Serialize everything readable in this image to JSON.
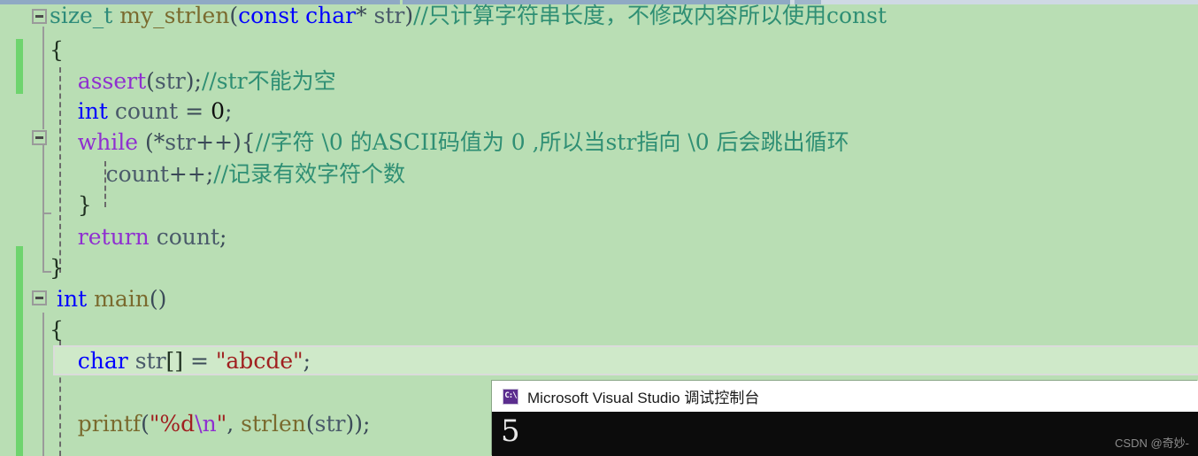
{
  "editor": {
    "background_color": "#b9deb4",
    "current_line_color": "#cfe9c9",
    "change_bar_color": "#6ed46e",
    "scrollbar": {
      "name": "horizontal-scrollbar"
    },
    "lines": [
      {
        "id": "line-1",
        "text": "size_t my_strlen(const char* str)//只计算字符串长度，不修改内容所以使用const",
        "tokens": [
          {
            "t": "size_t",
            "c": "t-type"
          },
          {
            "t": " ",
            "c": "t-punct"
          },
          {
            "t": "my_strlen",
            "c": "t-fnname"
          },
          {
            "t": "(",
            "c": "t-punct"
          },
          {
            "t": "const",
            "c": "t-keyword"
          },
          {
            "t": " ",
            "c": "t-punct"
          },
          {
            "t": "char",
            "c": "t-keyword"
          },
          {
            "t": "*",
            "c": "t-punct"
          },
          {
            "t": " ",
            "c": "t-punct"
          },
          {
            "t": "str",
            "c": "t-ident"
          },
          {
            "t": ")",
            "c": "t-punct"
          },
          {
            "t": "//只计算字符串长度，不修改内容所以使用const",
            "c": "t-comment"
          }
        ]
      },
      {
        "id": "line-2",
        "text": "{",
        "tokens": [
          {
            "t": "{",
            "c": "t-brace"
          }
        ]
      },
      {
        "id": "line-3",
        "text": "    assert(str);//str不能为空",
        "tokens": [
          {
            "t": "    ",
            "c": "t-punct"
          },
          {
            "t": "assert",
            "c": "t-ctrl"
          },
          {
            "t": "(",
            "c": "t-punct"
          },
          {
            "t": "str",
            "c": "t-ident"
          },
          {
            "t": ");",
            "c": "t-punct"
          },
          {
            "t": "//str不能为空",
            "c": "t-comment"
          }
        ]
      },
      {
        "id": "line-4",
        "text": "    int count = 0;",
        "tokens": [
          {
            "t": "    ",
            "c": "t-punct"
          },
          {
            "t": "int",
            "c": "t-keyword"
          },
          {
            "t": " ",
            "c": "t-punct"
          },
          {
            "t": "count",
            "c": "t-ident"
          },
          {
            "t": " = ",
            "c": "t-punct"
          },
          {
            "t": "0",
            "c": "t-num"
          },
          {
            "t": ";",
            "c": "t-punct"
          }
        ]
      },
      {
        "id": "line-5",
        "text": "    while (*str++){//字符 \\0 的ASCII码值为 0 ,所以当str指向 \\0 后会跳出循环",
        "tokens": [
          {
            "t": "    ",
            "c": "t-punct"
          },
          {
            "t": "while",
            "c": "t-ctrl"
          },
          {
            "t": " (*",
            "c": "t-punct"
          },
          {
            "t": "str",
            "c": "t-ident"
          },
          {
            "t": "++){",
            "c": "t-punct"
          },
          {
            "t": "//字符 \\0 的ASCII码值为 0 ,所以当str指向 \\0 后会跳出循环",
            "c": "t-comment"
          }
        ]
      },
      {
        "id": "line-6",
        "text": "        count++;//记录有效字符个数",
        "tokens": [
          {
            "t": "        ",
            "c": "t-punct"
          },
          {
            "t": "count",
            "c": "t-ident"
          },
          {
            "t": "++;",
            "c": "t-punct"
          },
          {
            "t": "//记录有效字符个数",
            "c": "t-comment"
          }
        ]
      },
      {
        "id": "line-7",
        "text": "    }",
        "tokens": [
          {
            "t": "    }",
            "c": "t-brace"
          }
        ]
      },
      {
        "id": "line-8",
        "text": "    return count;",
        "tokens": [
          {
            "t": "    ",
            "c": "t-punct"
          },
          {
            "t": "return",
            "c": "t-ctrl"
          },
          {
            "t": " ",
            "c": "t-punct"
          },
          {
            "t": "count",
            "c": "t-ident"
          },
          {
            "t": ";",
            "c": "t-punct"
          }
        ]
      },
      {
        "id": "line-9",
        "text": "}",
        "tokens": [
          {
            "t": "}",
            "c": "t-brace"
          }
        ]
      },
      {
        "id": "line-10",
        "text": "int main()",
        "tokens": [
          {
            "t": "int",
            "c": "t-keyword"
          },
          {
            "t": " ",
            "c": "t-punct"
          },
          {
            "t": "main",
            "c": "t-fnname"
          },
          {
            "t": "()",
            "c": "t-punct"
          }
        ]
      },
      {
        "id": "line-11",
        "text": "{",
        "tokens": [
          {
            "t": "{",
            "c": "t-brace"
          }
        ]
      },
      {
        "id": "line-12",
        "text": "    char str[] = \"abcde\";",
        "tokens": [
          {
            "t": "    ",
            "c": "t-punct"
          },
          {
            "t": "char",
            "c": "t-keyword"
          },
          {
            "t": " ",
            "c": "t-punct"
          },
          {
            "t": "str",
            "c": "t-ident"
          },
          {
            "t": "[]",
            "c": "t-brace"
          },
          {
            "t": " = ",
            "c": "t-punct"
          },
          {
            "t": "\"abcde\"",
            "c": "t-string"
          },
          {
            "t": ";",
            "c": "t-punct"
          }
        ]
      },
      {
        "id": "line-13",
        "text": "",
        "tokens": []
      },
      {
        "id": "line-14",
        "text": "    printf(\"%d\\n\", strlen(str));",
        "tokens": [
          {
            "t": "    ",
            "c": "t-punct"
          },
          {
            "t": "printf",
            "c": "t-fnname"
          },
          {
            "t": "(",
            "c": "t-punct"
          },
          {
            "t": "\"%d",
            "c": "t-string"
          },
          {
            "t": "\\n",
            "c": "t-escape"
          },
          {
            "t": "\"",
            "c": "t-string"
          },
          {
            "t": ", ",
            "c": "t-punct"
          },
          {
            "t": "strlen",
            "c": "t-fnname"
          },
          {
            "t": "(",
            "c": "t-punct"
          },
          {
            "t": "str",
            "c": "t-ident"
          },
          {
            "t": "));",
            "c": "t-punct"
          }
        ]
      }
    ]
  },
  "console": {
    "title": "Microsoft Visual Studio 调试控制台",
    "icon_label": "C:\\",
    "output": "5",
    "background_color": "#0c0c0c",
    "text_color": "#e8e8e8"
  },
  "watermark": {
    "text": "CSDN @奇妙-"
  }
}
